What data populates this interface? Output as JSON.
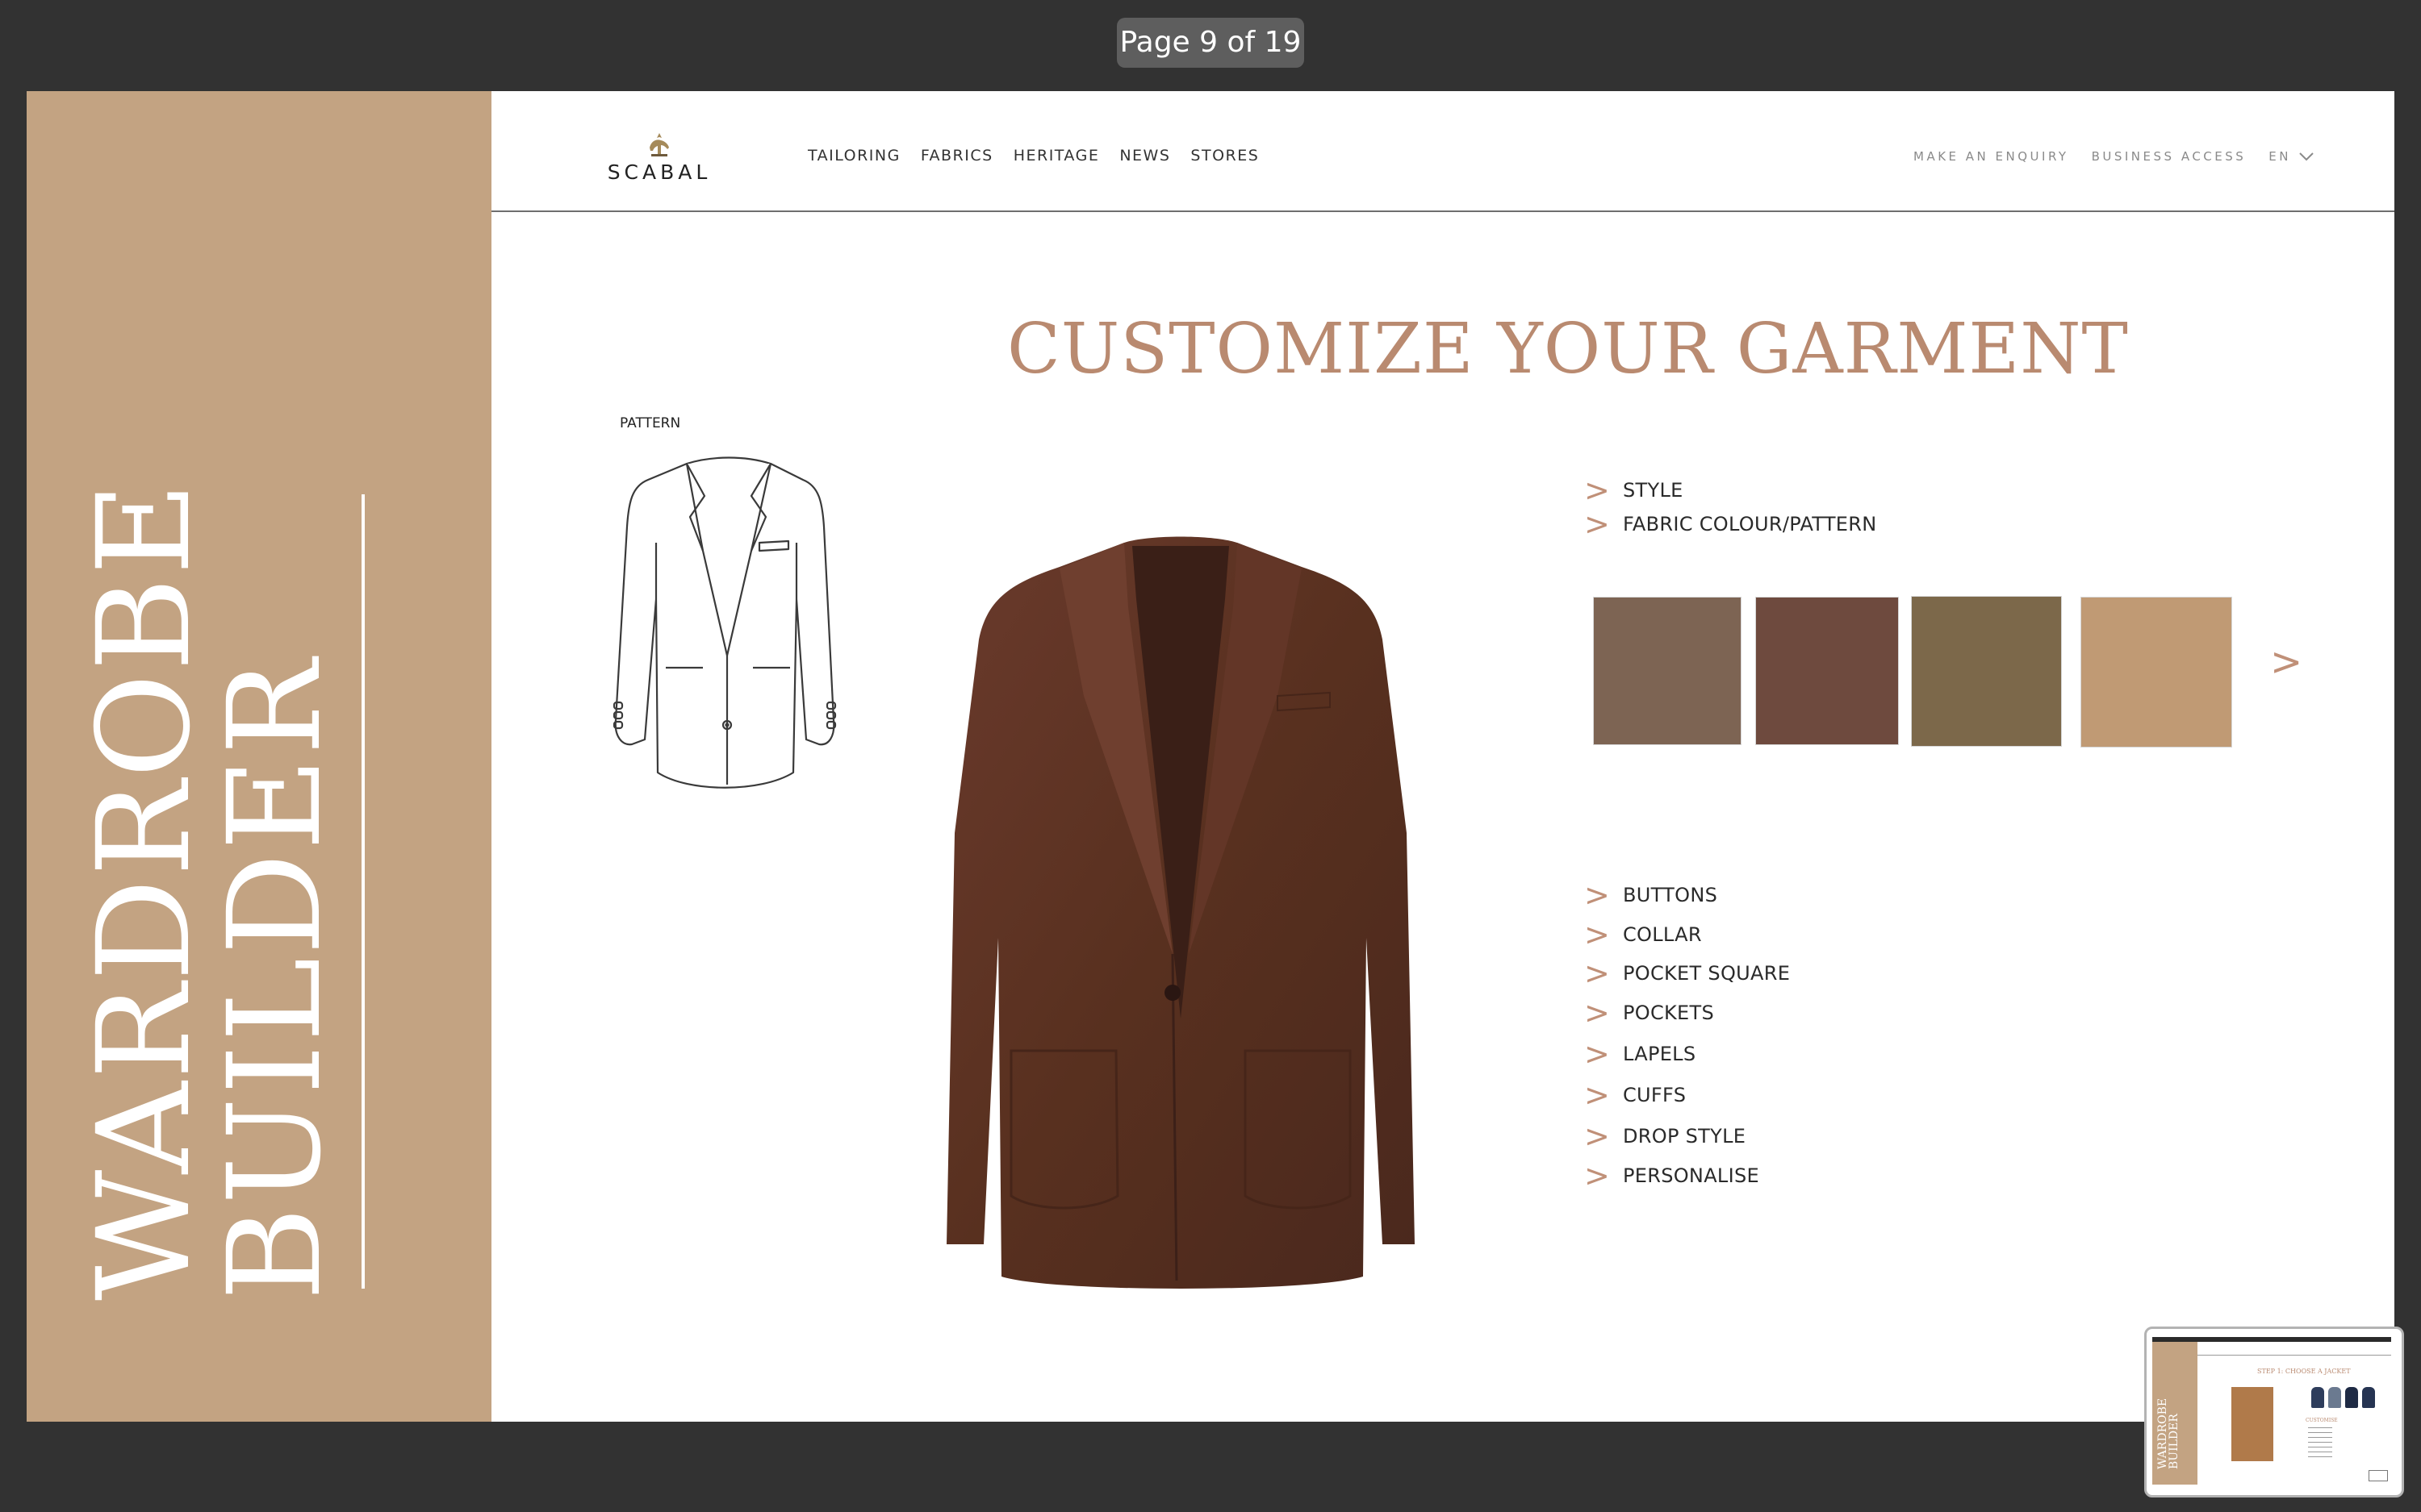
{
  "viewer": {
    "page_indicator": "Page 9 of 19"
  },
  "sidebar": {
    "title_line1": "WARDROBE",
    "title_line2": "BUILDER"
  },
  "header": {
    "logo_text": "SCABAL",
    "nav": [
      "TAILORING",
      "FABRICS",
      "HERITAGE",
      "NEWS",
      "STORES"
    ],
    "utility": {
      "enquiry": "MAKE AN ENQUIRY",
      "business": "BUSINESS ACCESS",
      "language": "EN"
    }
  },
  "main": {
    "title": "CUSTOMIZE YOUR GARMENT",
    "pattern_label": "PATTERN",
    "options_top": [
      "STYLE",
      "FABRIC COLOUR/PATTERN"
    ],
    "options_bottom": [
      "BUTTONS",
      "COLLAR",
      "POCKET SQUARE",
      "POCKETS",
      "LAPELS",
      "CUFFS",
      "DROP STYLE",
      "PERSONALISE"
    ],
    "swatches": [
      {
        "name": "taupe-brown",
        "color": "#7d6453"
      },
      {
        "name": "brown-tweed",
        "color": "#6e4a3e"
      },
      {
        "name": "olive-khaki",
        "color": "#7c684a"
      },
      {
        "name": "camel",
        "color": "#c09a74"
      }
    ],
    "garment_color": "#5a3126"
  },
  "thumbnail": {
    "title": "STEP 1: CHOOSE A JACKET",
    "side_title_line1": "WARDROBE",
    "side_title_line2": "BUILDER",
    "section": "CUSTOMISE"
  },
  "colors": {
    "sidebar": "#c3a382",
    "accent": "#b98a70",
    "chevron": "#c09078",
    "background": "#323232"
  }
}
